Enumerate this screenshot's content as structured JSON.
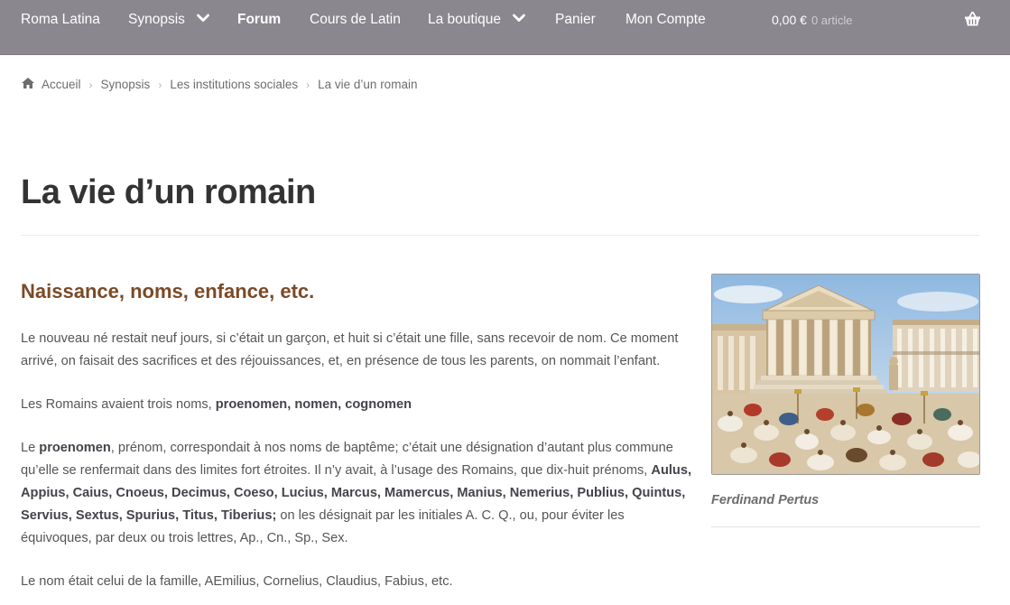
{
  "nav": {
    "brand": "Roma Latina",
    "items": [
      {
        "label": "Synopsis"
      },
      {
        "label": "Forum"
      },
      {
        "label": "Cours de Latin"
      },
      {
        "label": "La boutique"
      },
      {
        "label": "Panier"
      },
      {
        "label": "Mon Compte"
      }
    ],
    "cart_total": "0,00 €",
    "cart_count": "0 article",
    "basket_icon": "basket-icon"
  },
  "breadcrumb": {
    "home_icon": "home-icon",
    "items": [
      "Accueil",
      "Synopsis",
      "Les institutions sociales",
      "La vie d’un romain"
    ]
  },
  "page": {
    "title": "La vie d’un romain",
    "section_heading": "Naissance, noms, enfance, etc.",
    "paragraphs": {
      "p1": "Le nouveau né restait neuf jours, si c’était un garçon, et huit si c’était une fille, sans recevoir de nom. Ce moment arrivé, on faisait des sacrifices et des réjouissances, et, en présence de tous les parents, on nommait l’enfant.",
      "p2_text": "Les Romains avaient trois noms, ",
      "p2_bold": "proenomen, nomen, cognomen",
      "p3_text1": "Le ",
      "p3_bold1": "proenomen",
      "p3_text2": ", prénom, correspondait à nos noms de baptême; c’était une désignation d’autant plus commune qu’elle se renfermait dans des limites fort étroites. Il n’y avait, à l’usage des Romains, que dix-huit prénoms, ",
      "p3_bold2": "Aulus, Appius, Caius, Cnoeus, Decimus, Coeso, Lucius, Marcus, Mamercus, Manius, Nemerius, Publius, Quintus, Servius, Sextus, Spurius, Titus, Tiberius;",
      "p3_text3": " on les désignait par les initiales A. C. Q., ou, pour éviter les équivoques, par deux ou trois lettres, Ap., Cn., Sp., Sex.",
      "p4": "Le nom était celui de la famille, AEmilius, Cornelius, Claudius, Fabius, etc."
    }
  },
  "figure": {
    "caption": "Ferdinand Pertus"
  },
  "colors": {
    "nav_bg": "#8a878e",
    "heading_brown": "#7b4a26"
  }
}
